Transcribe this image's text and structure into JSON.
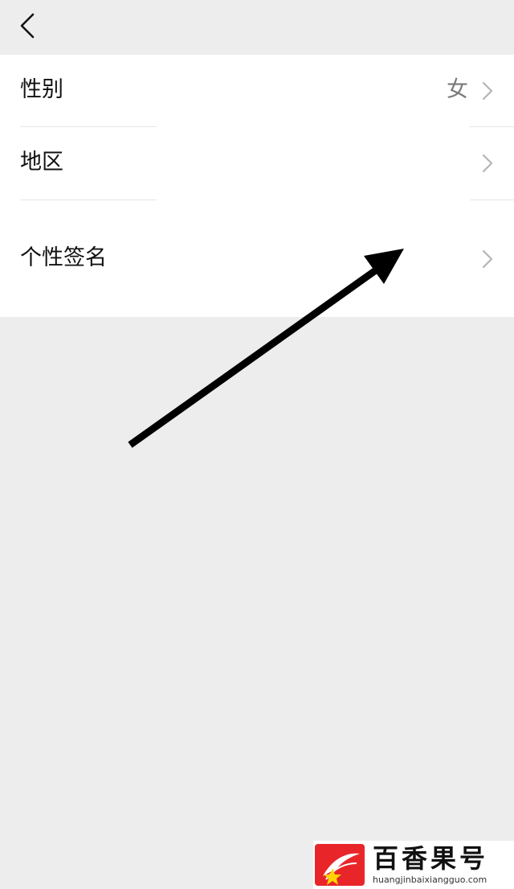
{
  "nav": {
    "back_icon": "chevron-left-icon"
  },
  "settings": {
    "items": [
      {
        "label": "性别",
        "value": "女",
        "icon": "chevron-right-icon"
      },
      {
        "label": "地区",
        "value": "",
        "icon": "chevron-right-icon"
      },
      {
        "label": "个性签名",
        "value": "",
        "icon": "chevron-right-icon"
      }
    ]
  },
  "annotation": {
    "icon": "arrow-icon",
    "color": "#000000"
  },
  "watermark": {
    "title": "百香果号",
    "url": "huangjinbaixiangguo.com",
    "logo": "logo-icon",
    "logo_color": "#e8262a",
    "star_color": "#ffd400"
  }
}
